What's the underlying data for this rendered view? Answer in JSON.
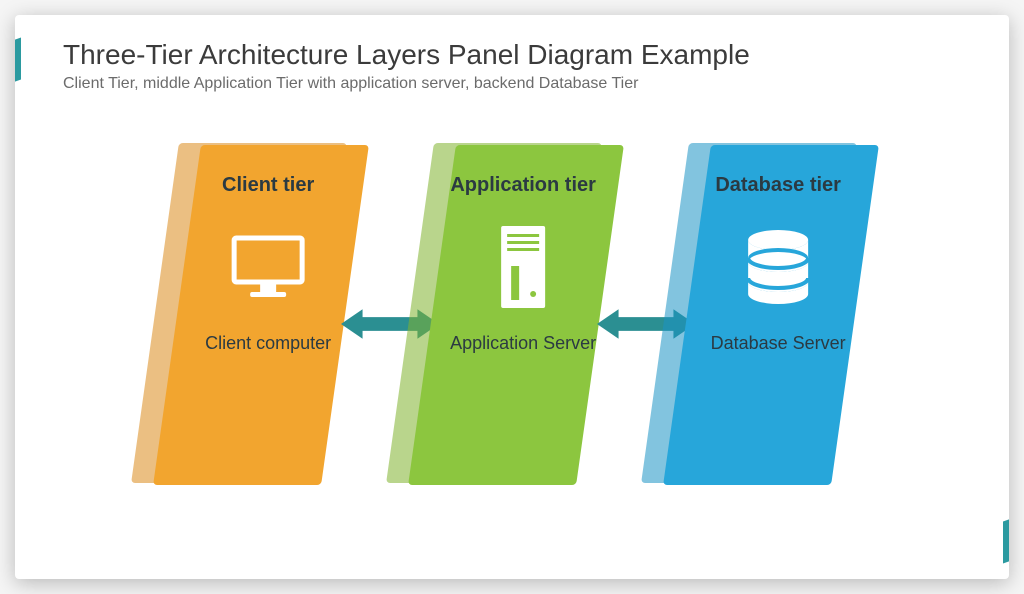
{
  "header": {
    "title": "Three-Tier Architecture Layers Panel Diagram Example",
    "subtitle": "Client Tier, middle Application Tier with application server, backend Database Tier"
  },
  "panels": [
    {
      "title": "Client tier",
      "caption": "Client computer",
      "icon": "monitor",
      "color": "orange"
    },
    {
      "title": "Application tier",
      "caption": "Application Server",
      "icon": "server",
      "color": "green"
    },
    {
      "title": "Database tier",
      "caption": "Database Server",
      "icon": "database",
      "color": "blue"
    }
  ],
  "colors": {
    "arrow": "#2b8f92",
    "orange": "#f2a52f",
    "green": "#8cc63f",
    "blue": "#27a6da"
  }
}
